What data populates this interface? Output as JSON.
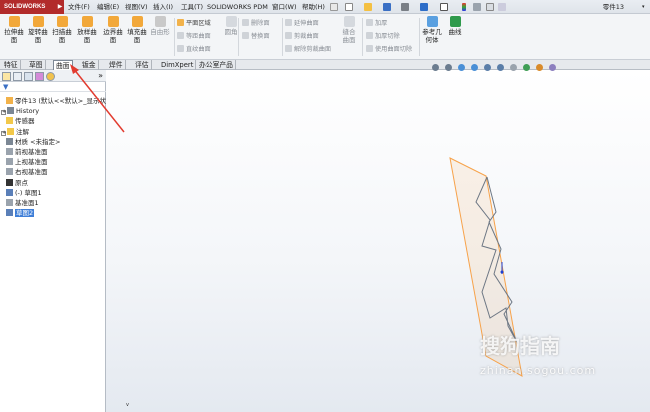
{
  "app": {
    "logo_text": "SOLIDWORKS",
    "document_title": "零件13"
  },
  "menu": [
    "文件(F)",
    "编辑(E)",
    "视图(V)",
    "插入(I)",
    "工具(T)",
    "SOLIDWORKS PDM",
    "窗口(W)",
    "帮助(H)"
  ],
  "ribbon": {
    "big_buttons": [
      {
        "label": "拉伸曲\n面",
        "icon": "extruded-surface-icon",
        "color": "#f2a83a"
      },
      {
        "label": "旋转曲\n面",
        "icon": "revolved-surface-icon",
        "color": "#f2a83a"
      },
      {
        "label": "扫描曲\n面",
        "icon": "swept-surface-icon",
        "color": "#f2a83a"
      },
      {
        "label": "放样曲\n面",
        "icon": "lofted-surface-icon",
        "color": "#f2a83a"
      },
      {
        "label": "边界曲\n面",
        "icon": "boundary-surface-icon",
        "color": "#f2a83a"
      },
      {
        "label": "填充曲\n面",
        "icon": "filled-surface-icon",
        "color": "#f2a83a"
      },
      {
        "label": "自由形",
        "icon": "freeform-icon",
        "color": "#c9c9c9"
      }
    ],
    "group1": [
      "平面区域",
      "等距曲面",
      "直纹曲面"
    ],
    "fillet_label": "圆角",
    "group2": [
      "删除面",
      "替换面"
    ],
    "group3": [
      "延伸曲面",
      "剪裁曲面",
      "解除剪裁曲面"
    ],
    "knit_label": "缝合\n曲面",
    "group4": [
      "加厚",
      "加厚切除",
      "使用曲面切除"
    ],
    "ref_geometry_label": "参考几\n何体",
    "curves_label": "曲线"
  },
  "tabs": [
    "特征",
    "草图",
    "曲面",
    "钣金",
    "焊件",
    "评估",
    "DimXpert",
    "办公室产品"
  ],
  "active_tab": "曲面",
  "feature_tree": [
    {
      "label": "零件13 (默认<<默认>_显示状",
      "icon": "part-icon",
      "indent": 0,
      "expander": ""
    },
    {
      "label": "History",
      "icon": "history-icon",
      "indent": 0,
      "expander": "+"
    },
    {
      "label": "传感器",
      "icon": "sensor-icon",
      "indent": 0,
      "expander": ""
    },
    {
      "label": "注解",
      "icon": "annotation-icon",
      "indent": 0,
      "expander": "+"
    },
    {
      "label": "材质 <未指定>",
      "icon": "material-icon",
      "indent": 0,
      "expander": ""
    },
    {
      "label": "前视基准面",
      "icon": "plane-icon",
      "indent": 0,
      "expander": ""
    },
    {
      "label": "上视基准面",
      "icon": "plane-icon",
      "indent": 0,
      "expander": ""
    },
    {
      "label": "右视基准面",
      "icon": "plane-icon",
      "indent": 0,
      "expander": ""
    },
    {
      "label": "原点",
      "icon": "origin-icon",
      "indent": 0,
      "expander": ""
    },
    {
      "label": "(-) 草图1",
      "icon": "sketch-icon",
      "indent": 0,
      "expander": ""
    },
    {
      "label": "基准面1",
      "icon": "plane-icon",
      "indent": 0,
      "expander": ""
    },
    {
      "label": "草图2",
      "icon": "sketch-icon",
      "indent": 0,
      "expander": "",
      "selected": true
    }
  ],
  "watermark": {
    "text": "搜狗指南",
    "url": "zhinan.sogou.com"
  },
  "colors": {
    "accent": "#3f7fd8",
    "plane": "#f7a24a",
    "annotation_arrow": "#e23b2f",
    "logo": "#b22b2b"
  }
}
